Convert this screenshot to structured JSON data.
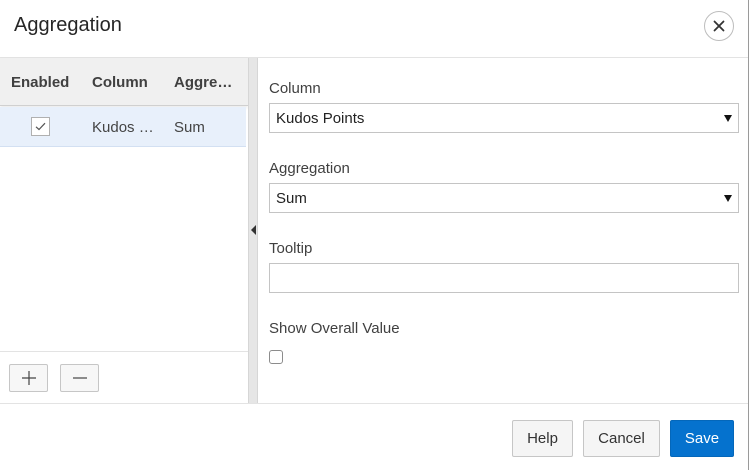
{
  "dialog": {
    "title": "Aggregation",
    "close_icon": "close-icon"
  },
  "grid": {
    "columns": [
      "Enabled",
      "Column",
      "Aggre…"
    ],
    "rows": [
      {
        "enabled": true,
        "column": "Kudos …",
        "aggregation": "Sum"
      }
    ],
    "add_icon": "plus-icon",
    "remove_icon": "minus-icon"
  },
  "splitter": {
    "icon": "collapse-left-arrow-icon"
  },
  "form": {
    "column": {
      "label": "Column",
      "value": "Kudos Points"
    },
    "aggregation": {
      "label": "Aggregation",
      "value": "Sum"
    },
    "tooltip": {
      "label": "Tooltip",
      "value": ""
    },
    "show_overall": {
      "label": "Show Overall Value",
      "checked": false
    }
  },
  "footer": {
    "help": "Help",
    "cancel": "Cancel",
    "save": "Save"
  },
  "colors": {
    "primary": "#0572ce",
    "selected_row": "#e8f0fb"
  }
}
